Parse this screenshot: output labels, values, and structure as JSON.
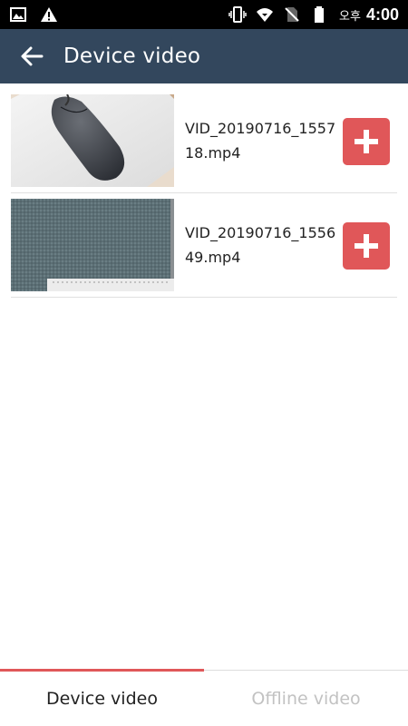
{
  "status_bar": {
    "ampm": "오후",
    "time": "4:00",
    "icons_left": [
      "image-icon",
      "warning-icon"
    ],
    "icons_right": [
      "vibrate-icon",
      "wifi-icon",
      "no-sim-icon",
      "battery-icon"
    ]
  },
  "app_bar": {
    "title": "Device video",
    "back_icon": "back-arrow-icon"
  },
  "videos": [
    {
      "name": "VID_20190716_155718.mp4",
      "thumbnail": "mouse-on-pad",
      "action_icon": "plus-icon"
    },
    {
      "name": "VID_20190716_155649.mp4",
      "thumbnail": "gray-fabric",
      "action_icon": "plus-icon"
    }
  ],
  "tabs": [
    {
      "label": "Device video",
      "active": true
    },
    {
      "label": "Offline video",
      "active": false
    }
  ],
  "colors": {
    "status_bar": "#000000",
    "app_bar": "#33475d",
    "accent": "#e05759",
    "inactive_tab_text": "#c2c2c2"
  }
}
